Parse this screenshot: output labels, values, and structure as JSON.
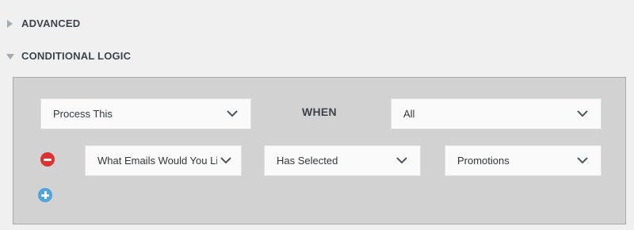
{
  "sections": {
    "advanced": {
      "title": "ADVANCED",
      "expanded": false
    },
    "conditional_logic": {
      "title": "CONDITIONAL LOGIC",
      "expanded": true
    }
  },
  "logic": {
    "action_select": {
      "value": "Process This"
    },
    "when_label": "WHEN",
    "match_select": {
      "value": "All"
    },
    "rules": [
      {
        "field": "What Emails Would You Li",
        "operator": "Has Selected",
        "value": "Promotions"
      }
    ]
  },
  "icons": {
    "section_collapsed": "triangle-right-icon",
    "section_expanded": "triangle-down-icon",
    "dropdown": "chevron-down-icon",
    "remove_rule": "minus-circle-icon",
    "add_rule": "plus-circle-icon"
  },
  "colors": {
    "page_background": "#f0f0f1",
    "panel_background": "#d2d2d2",
    "remove_button": "#dc3232",
    "add_button": "#4ea5dd"
  }
}
